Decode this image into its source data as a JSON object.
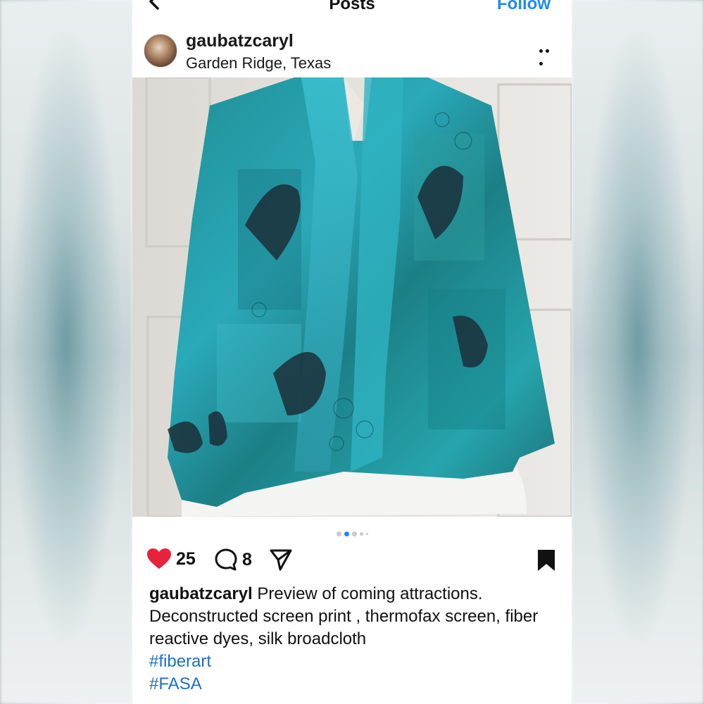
{
  "topbar": {
    "title": "Posts",
    "follow_label": "Follow"
  },
  "post": {
    "username": "gaubatzcaryl",
    "location": "Garden Ridge, Texas",
    "likes": "25",
    "comments": "8",
    "carousel": {
      "count": 5,
      "active_index": 1
    },
    "caption": {
      "user": "gaubatzcaryl",
      "text": "Preview of coming attractions. Deconstructed screen print , thermofax screen, fiber reactive dyes, silk broadcloth",
      "hashtags": [
        "#fiberart",
        "#FASA"
      ]
    }
  },
  "colors": {
    "accent": "#1d8bef",
    "like": "#e8223d",
    "hashtag": "#1a6fd1"
  },
  "icons": {
    "back": "chevron-left-icon",
    "more": "more-horizontal-icon",
    "like": "heart-icon",
    "comment": "comment-icon",
    "share": "send-icon",
    "save": "bookmark-icon"
  }
}
